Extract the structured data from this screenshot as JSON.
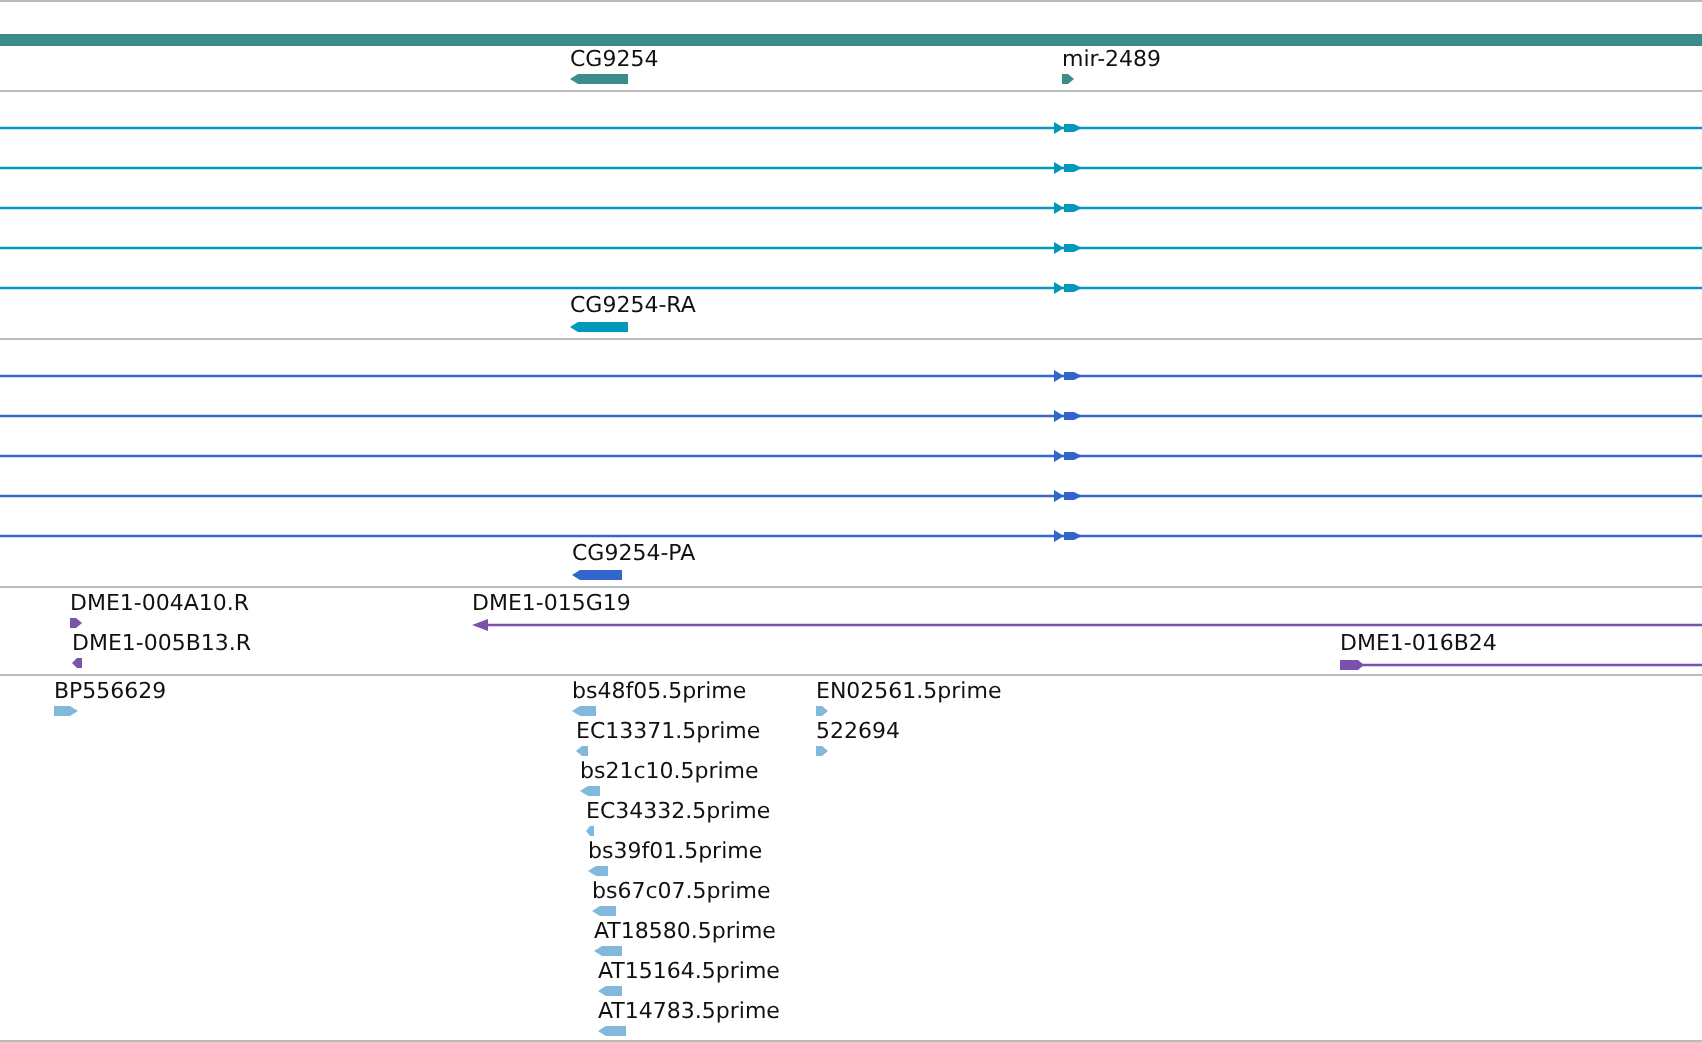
{
  "tracks": [
    {
      "color": "#3d8c8c",
      "features": [
        {
          "kind": "block",
          "label": "CG9254",
          "forward": false
        },
        {
          "kind": "block",
          "label": "mir-2489",
          "forward": true
        }
      ]
    },
    {
      "color": "#0099bb",
      "features": [
        {
          "kind": "line",
          "forward": true
        },
        {
          "kind": "line",
          "forward": true
        },
        {
          "kind": "line",
          "forward": true
        },
        {
          "kind": "line",
          "forward": true
        },
        {
          "kind": "line",
          "forward": true
        },
        {
          "kind": "block",
          "label": "CG9254-RA",
          "forward": false
        }
      ]
    },
    {
      "color": "#3366cc",
      "features": [
        {
          "kind": "line",
          "forward": true
        },
        {
          "kind": "line",
          "forward": true
        },
        {
          "kind": "line",
          "forward": true
        },
        {
          "kind": "line",
          "forward": true
        },
        {
          "kind": "line",
          "forward": true
        },
        {
          "kind": "block",
          "label": "CG9254-PA",
          "forward": false
        }
      ]
    },
    {
      "color": "#7b52ab",
      "features": [
        {
          "kind": "block",
          "label": "DME1-004A10.R",
          "forward": true
        },
        {
          "kind": "block",
          "label": "DME1-005B13.R",
          "forward": false
        },
        {
          "kind": "span",
          "label": "DME1-015G19",
          "forward": false
        },
        {
          "kind": "span",
          "label": "DME1-016B24",
          "forward": true
        }
      ]
    },
    {
      "color": "#82b8dc",
      "features": [
        {
          "kind": "block",
          "label": "BP556629",
          "forward": true
        },
        {
          "kind": "block",
          "label": "bs48f05.5prime",
          "forward": false
        },
        {
          "kind": "block",
          "label": "EC13371.5prime",
          "forward": false
        },
        {
          "kind": "block",
          "label": "bs21c10.5prime",
          "forward": false
        },
        {
          "kind": "block",
          "label": "EC34332.5prime",
          "forward": false
        },
        {
          "kind": "block",
          "label": "bs39f01.5prime",
          "forward": false
        },
        {
          "kind": "block",
          "label": "bs67c07.5prime",
          "forward": false
        },
        {
          "kind": "block",
          "label": "AT18580.5prime",
          "forward": false
        },
        {
          "kind": "block",
          "label": "AT15164.5prime",
          "forward": false
        },
        {
          "kind": "block",
          "label": "AT14783.5prime",
          "forward": false
        },
        {
          "kind": "block",
          "label": "EN02561.5prime",
          "forward": true
        },
        {
          "kind": "block",
          "label": "522694",
          "forward": true
        }
      ]
    }
  ]
}
